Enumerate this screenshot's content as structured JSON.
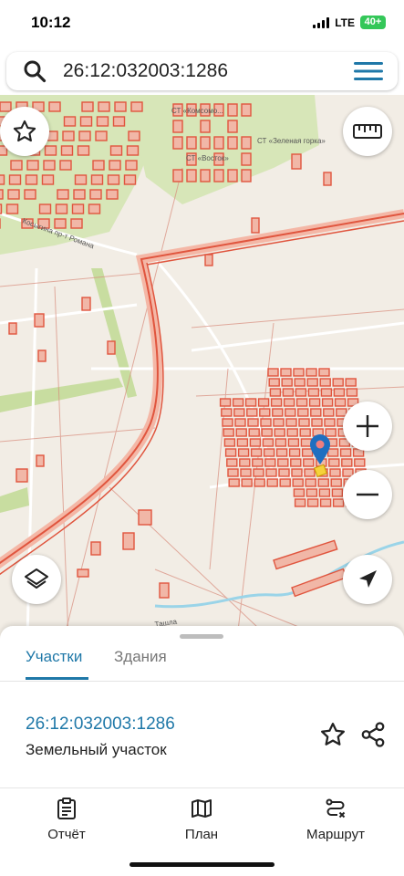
{
  "status_bar": {
    "time": "10:12",
    "network": "LTE",
    "battery": "40+"
  },
  "search": {
    "query": "26:12:032003:1286",
    "placeholder": ""
  },
  "map": {
    "labels": {
      "st_komsomolets": "СТ «Комсомо...",
      "st_zelenaya_gorka": "СТ «Зеленая горка»",
      "st_vostok": "СТ «Восток»",
      "street_kosygina": "Косыгина пр-т Романа",
      "river": "Ташла"
    },
    "colors": {
      "parcel_outline": "#e0553e",
      "parcel_fill": "#f1b7a7",
      "greenery": "#d7e6b8",
      "ground": "#f2ede5",
      "road": "#ffffff",
      "water": "#9ad4e8",
      "pin": "#1f6fc0",
      "selected_parcel": "#f5d23a"
    }
  },
  "map_controls": {
    "favorite_icon": "star-outline-icon",
    "ruler_icon": "ruler-icon",
    "zoom_in_icon": "plus-icon",
    "zoom_out_icon": "minus-icon",
    "layers_icon": "layers-icon",
    "locate_icon": "navigation-arrow-icon"
  },
  "sheet": {
    "tabs": [
      {
        "label": "Участки",
        "active": true
      },
      {
        "label": "Здания",
        "active": false
      }
    ],
    "parcel": {
      "number": "26:12:032003:1286",
      "type": "Земельный участок"
    },
    "accent_color": "#1f78a8"
  },
  "bottom_nav": {
    "items": [
      {
        "label": "Отчёт",
        "icon": "clipboard-icon"
      },
      {
        "label": "План",
        "icon": "map-icon"
      },
      {
        "label": "Маршрут",
        "icon": "route-icon"
      }
    ]
  }
}
